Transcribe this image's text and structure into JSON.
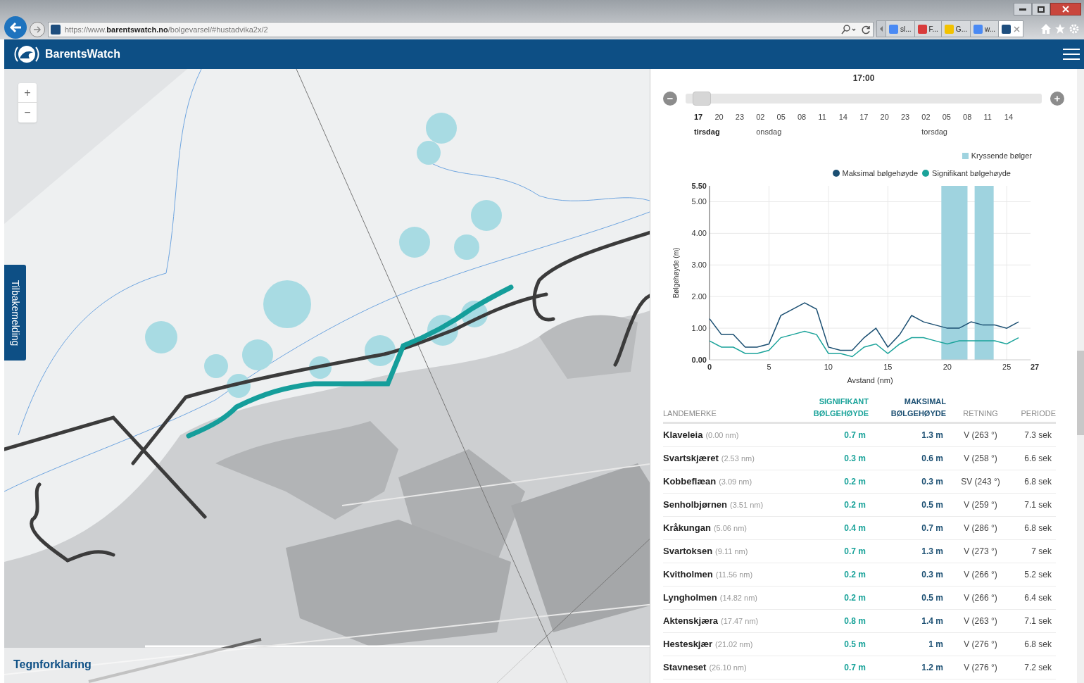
{
  "browser": {
    "address": "https://www.**barentswatch.no**/bolgevarsel/#hustadvika2x/2",
    "tabs": [
      {
        "label": "sl...",
        "selected": false,
        "color": "#4a8af4"
      },
      {
        "label": "F...",
        "selected": false,
        "color": "#d83b3b"
      },
      {
        "label": "G...",
        "selected": false,
        "color": "#f2c200"
      },
      {
        "label": "w...",
        "selected": false,
        "color": "#4a8af4"
      },
      {
        "selected": true,
        "color": "#1e4e7e"
      }
    ]
  },
  "app_bar": {
    "brand": "BarentsWatch"
  },
  "map": {
    "zoom_in": "+",
    "zoom_out": "−",
    "feedback_tab": "Tilbakemelding",
    "legend_toggle": "Tegnforklaring"
  },
  "forecast": {
    "time": "17:00",
    "minus": "−",
    "plus": "+",
    "slider": {
      "level": 0.02
    },
    "hours": [
      {
        "label": "17",
        "current": true,
        "day": "tirsdag"
      },
      {
        "label": "20",
        "current": false
      },
      {
        "label": "23",
        "current": false
      },
      {
        "label": "02",
        "current": false,
        "day": "onsdag"
      },
      {
        "label": "05",
        "current": false
      },
      {
        "label": "08",
        "current": false
      },
      {
        "label": "11",
        "current": false
      },
      {
        "label": "14",
        "current": false
      },
      {
        "label": "17",
        "current": false
      },
      {
        "label": "20",
        "current": false
      },
      {
        "label": "23",
        "current": false
      },
      {
        "label": "02",
        "current": false,
        "day": "torsdag"
      },
      {
        "label": "05",
        "current": false
      },
      {
        "label": "08",
        "current": false
      },
      {
        "label": "11",
        "current": false
      },
      {
        "label": "14",
        "current": false
      }
    ]
  },
  "chart": {
    "band_legend": "Kryssende bølger",
    "chart_data": {
      "type": "line",
      "xlabel": "Avstand (nm)",
      "ylabel": "Bølgehøyde (m)",
      "x": [
        0,
        1,
        2,
        3,
        4,
        5,
        6,
        7,
        8,
        9,
        10,
        11,
        12,
        13,
        14,
        15,
        16,
        17,
        18,
        19,
        20,
        21,
        22,
        23,
        24,
        25,
        26
      ],
      "series": [
        {
          "name": "Maksimal bølgehøyde",
          "color": "#1b4f72",
          "values": [
            1.3,
            0.8,
            0.8,
            0.4,
            0.4,
            0.5,
            1.4,
            1.6,
            1.8,
            1.6,
            0.4,
            0.3,
            0.3,
            0.7,
            1.0,
            0.4,
            0.8,
            1.4,
            1.2,
            1.1,
            1.0,
            1.0,
            1.2,
            1.1,
            1.1,
            1.0,
            1.2
          ]
        },
        {
          "name": "Signifikant bølgehøyde",
          "color": "#1aa39a",
          "values": [
            0.6,
            0.4,
            0.4,
            0.2,
            0.2,
            0.3,
            0.7,
            0.8,
            0.9,
            0.8,
            0.2,
            0.2,
            0.1,
            0.4,
            0.5,
            0.2,
            0.5,
            0.7,
            0.7,
            0.6,
            0.5,
            0.6,
            0.6,
            0.6,
            0.6,
            0.5,
            0.7
          ]
        }
      ],
      "xlim": [
        0,
        27
      ],
      "ylim": [
        0,
        5.5
      ],
      "xticks": [
        0,
        5,
        10,
        15,
        20,
        25,
        27
      ],
      "yticks": [
        {
          "value": 0,
          "label": "0.00"
        },
        {
          "value": 1,
          "label": "1.00"
        },
        {
          "value": 2,
          "label": "2.00"
        },
        {
          "value": 3,
          "label": "3.00"
        },
        {
          "value": 4,
          "label": "4.00"
        },
        {
          "value": 5,
          "label": "5.00"
        },
        {
          "value": 5.5,
          "label": "5.50"
        }
      ],
      "grid": true,
      "bands": [
        {
          "axis": "x",
          "from": 19.5,
          "to": 21.7,
          "color": "#9fd3df"
        },
        {
          "axis": "x",
          "from": 22.3,
          "to": 23.9,
          "color": "#9fd3df"
        }
      ]
    }
  },
  "table": {
    "columns": [
      {
        "label": "LANDEMERKE",
        "kind": "plain"
      },
      {
        "label": "SIGNIFIKANT BØLGEHØYDE",
        "kind": "sig"
      },
      {
        "label": "MAKSIMAL BØLGEHØYDE",
        "kind": "max"
      },
      {
        "label": "RETNING",
        "kind": "plain"
      },
      {
        "label": "PERIODE",
        "kind": "plain"
      }
    ],
    "rows": [
      {
        "name": "Klaveleia",
        "distance": "(0.00 nm)",
        "sig": "0.7 m",
        "max": "1.3 m",
        "direction": "V (263 °)",
        "period": "7.3 sek"
      },
      {
        "name": "Svartskjæret",
        "distance": "(2.53 nm)",
        "sig": "0.3 m",
        "max": "0.6 m",
        "direction": "V (258 °)",
        "period": "6.6 sek"
      },
      {
        "name": "Kobbeflæan",
        "distance": "(3.09 nm)",
        "sig": "0.2 m",
        "max": "0.3 m",
        "direction": "SV (243 °)",
        "period": "6.8 sek"
      },
      {
        "name": "Senholbjørnen",
        "distance": "(3.51 nm)",
        "sig": "0.2 m",
        "max": "0.5 m",
        "direction": "V (259 °)",
        "period": "7.1 sek"
      },
      {
        "name": "Kråkungan",
        "distance": "(5.06 nm)",
        "sig": "0.4 m",
        "max": "0.7 m",
        "direction": "V (286 °)",
        "period": "6.8 sek"
      },
      {
        "name": "Svartoksen",
        "distance": "(9.11 nm)",
        "sig": "0.7 m",
        "max": "1.3 m",
        "direction": "V (273 °)",
        "period": "7 sek"
      },
      {
        "name": "Kvitholmen",
        "distance": "(11.56 nm)",
        "sig": "0.2 m",
        "max": "0.3 m",
        "direction": "V (266 °)",
        "period": "5.2 sek"
      },
      {
        "name": "Lyngholmen",
        "distance": "(14.82 nm)",
        "sig": "0.2 m",
        "max": "0.5 m",
        "direction": "V (266 °)",
        "period": "6.4 sek"
      },
      {
        "name": "Aktenskjæra",
        "distance": "(17.47 nm)",
        "sig": "0.8 m",
        "max": "1.4 m",
        "direction": "V (263 °)",
        "period": "7.1 sek"
      },
      {
        "name": "Hesteskjær",
        "distance": "(21.02 nm)",
        "sig": "0.5 m",
        "max": "1 m",
        "direction": "V (276 °)",
        "period": "6.8 sek"
      },
      {
        "name": "Stavneset",
        "distance": "(26.10 nm)",
        "sig": "0.7 m",
        "max": "1.2 m",
        "direction": "V (276 °)",
        "period": "7.2 sek"
      }
    ]
  }
}
